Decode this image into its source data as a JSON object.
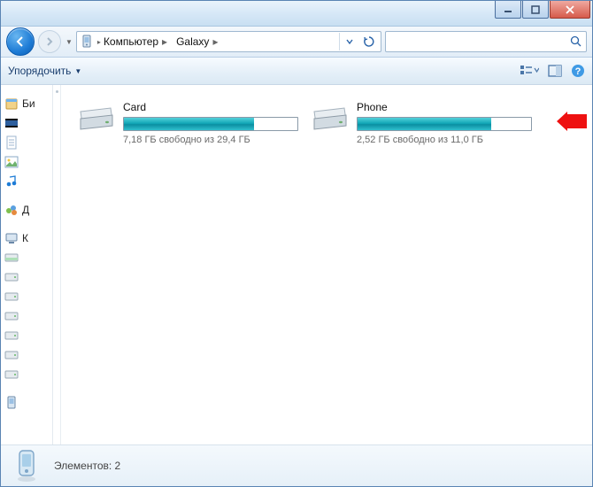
{
  "breadcrumb": {
    "root": "Компьютер",
    "child": "Galaxy"
  },
  "toolbar": {
    "organize": "Упорядочить"
  },
  "sidebar": {
    "lib_label": "Би",
    "home_label": "Д",
    "comp_label": "К"
  },
  "drives": [
    {
      "name": "Card",
      "stat": "7,18 ГБ свободно из 29,4 ГБ",
      "fill_pct": 75
    },
    {
      "name": "Phone",
      "stat": "2,52 ГБ свободно из 11,0 ГБ",
      "fill_pct": 77
    }
  ],
  "status": {
    "text": "Элементов: 2"
  }
}
